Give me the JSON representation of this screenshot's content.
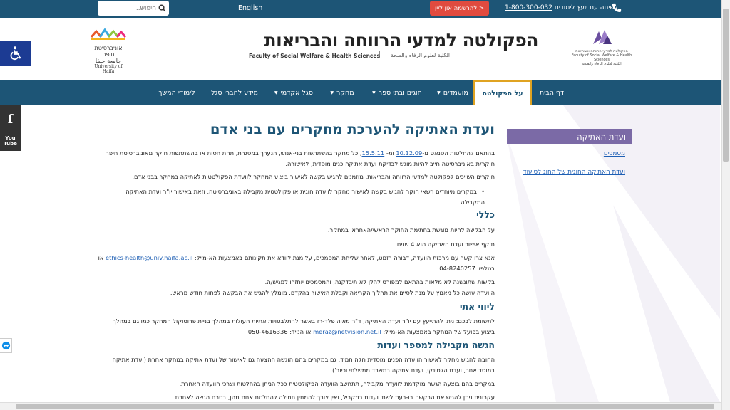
{
  "topbar": {
    "search_placeholder": "חיפוש...",
    "language": "English",
    "register": "להרשמה און ליין >",
    "phone_text": "לשיחה עם יועץ לימודים",
    "phone_number": "1-800-300-032"
  },
  "header": {
    "title": "הפקולטה למדעי הרווחה והבריאות",
    "subtitle_en": "Faculty of Social Welfare & Health Sciences",
    "separator": "|",
    "subtitle_ar": "الكلية لعلوم الرفاه والصحة",
    "haifa_logo_he": "אוניברסיטת חיפה",
    "haifa_logo_ar": "جامعة حيفا",
    "haifa_logo_en": "University of Haifa",
    "faculty_logo_he": "הפקולטה למדעי הרווחה והבריאות",
    "faculty_logo_en": "Faculty of Social Welfare & Health Sciences",
    "faculty_logo_ar": "الكلية لعلوم الرفاه والصحة"
  },
  "nav": {
    "items": [
      {
        "label": "דף הבית"
      },
      {
        "label": "על הפקולטה"
      },
      {
        "label": "מועמדים"
      },
      {
        "label": "חוגים ובתי ספר"
      },
      {
        "label": "מחקר"
      },
      {
        "label": "סגל אקדמי"
      },
      {
        "label": "מידע לחברי סגל"
      },
      {
        "label": "לימודי המשך"
      }
    ]
  },
  "social": {
    "youtube_top": "You",
    "youtube_bottom": "Tube",
    "facebook": "f"
  },
  "sidebar": {
    "title": "ועדת האתיקה",
    "links": [
      {
        "label": "מסמכים"
      },
      {
        "label": "ועדת האתיקה החוגית של החוג לסיעוד"
      }
    ]
  },
  "main": {
    "title": "ועדת האתיקה להערכת מחקרים עם בני אדם",
    "p1_pre": "בהתאם להחלטות הסנאט מ-",
    "p1_date1": "10.12.09",
    "p1_mid": " ומ- ",
    "p1_date2": "15.5.11",
    "p1_post": ", כל מחקר בהשתתפות בני-אנוש, הנערך במסגרת, תחת חסות או בהשתתפות חוקר מאוניברסיטת חיפה",
    "p1_line2": "חוקר/ת באוניברסיטה חייב להיות מוגש לבדיקת ועדת אתיקה כנים מוסדית, לאישורה.",
    "p2": "חוקרים השייכים לפקולטה למדעי הרווחה והבריאות, מוזמנים להגיש בקשה לאישור ביצוע המחקר לוועדת הפקולטטית לאתיקה במחקר בבני אדם.",
    "bullet1_line1": "במקרים מיוחדים רשאי חוקר להגיש בקשה לאישור מחקר לוועדה חוגית או פקולטטית מקבילה באוניברסיטה, וזאת באישור יו\"ר ועדת האתיקה",
    "bullet1_line2": "המקבילה.",
    "h_general": "כללי",
    "g1": "על הבקשה להיות מוגשת בחתימת החוקר הראשי/האחראי במחקר.",
    "g2": "תוקף אישור ועדת האתיקה הוא 4 שנים.",
    "g3_pre": "אנא צרו קשר עם מרכזת הוועדה, דבורה רזמט, לאחר שליחת המסמכים, על מנת לוודא את תקינותם באמצעות הא-מייל: ",
    "g3_email": "ethics-health@univ.haifa.ac.il",
    "g3_post": " או",
    "g3_line2": "בטלפון 04-8240257.",
    "g4_line1": "בקשות שתוגשנה לא מלאות בהתאם למפורט להלן לא תיבדקנה, והמסמכים יוחזרו למגיש/ה.",
    "g4_line2": "הוועדה עושה כל מאמץ על מנת לסיים את תהליך הקריאה וקבלת האישור בהקדם. מומלץ להגיש את הבקשה לפחות חודש מראש.",
    "h_escort": "ליווי אתי",
    "e1_line1": "לתשומת לבכם: ניתן להתייעץ עם יו\"ר ועדת האתיקה, ד\"ר מאיה פלד-רז באשר להתלבטויות אתיות העולות במהלך בניית פרוטוקול המחקר כמו גם במהלך",
    "e1_pre": "ביצוע בפועל של המחקר באמצעות הא-מייל: ",
    "e1_email": "meraz@netvision.net.il",
    "e1_post": " או הנייד: 050-4616336",
    "h_parallel": "הגשה מקבילה למספר ועדות",
    "pa1_line1": "החובה להגיש מחקר לאישור הוועדה הפנים מוסדית חלה תמיד, גם במקרים בהם הוגשה ההצעה גם לאישור של ועדת אתיקה במחקר אחרת (ועדת אתיקה",
    "pa1_line2": "במוסד אחר, ועדת הלסינקי, ועדת אתיקה במשרד ממשלתי וכיוב').",
    "pa2": "במקרים בהם בוצעה הגשה מוקדמת לוועדה מקבילה, תתחשב הוועדה הפקולטטית ככל הניתן בהחלטות וצרכי הוועדה האחרת.",
    "pa3": "עקרונית ניתן להגיש את הבקשה בו-בעת לשתי ועדות במקביל, ואין צורך להמתין תחילה להחלטת אחת מהן, בטרם הגשה לאחרת."
  },
  "colors": {
    "brand_blue": "#1d5576",
    "sidebar_purple": "#7b6aa6",
    "register_red": "#e04b3f",
    "link_blue": "#1e5fb4",
    "active_border": "#e0a321"
  }
}
